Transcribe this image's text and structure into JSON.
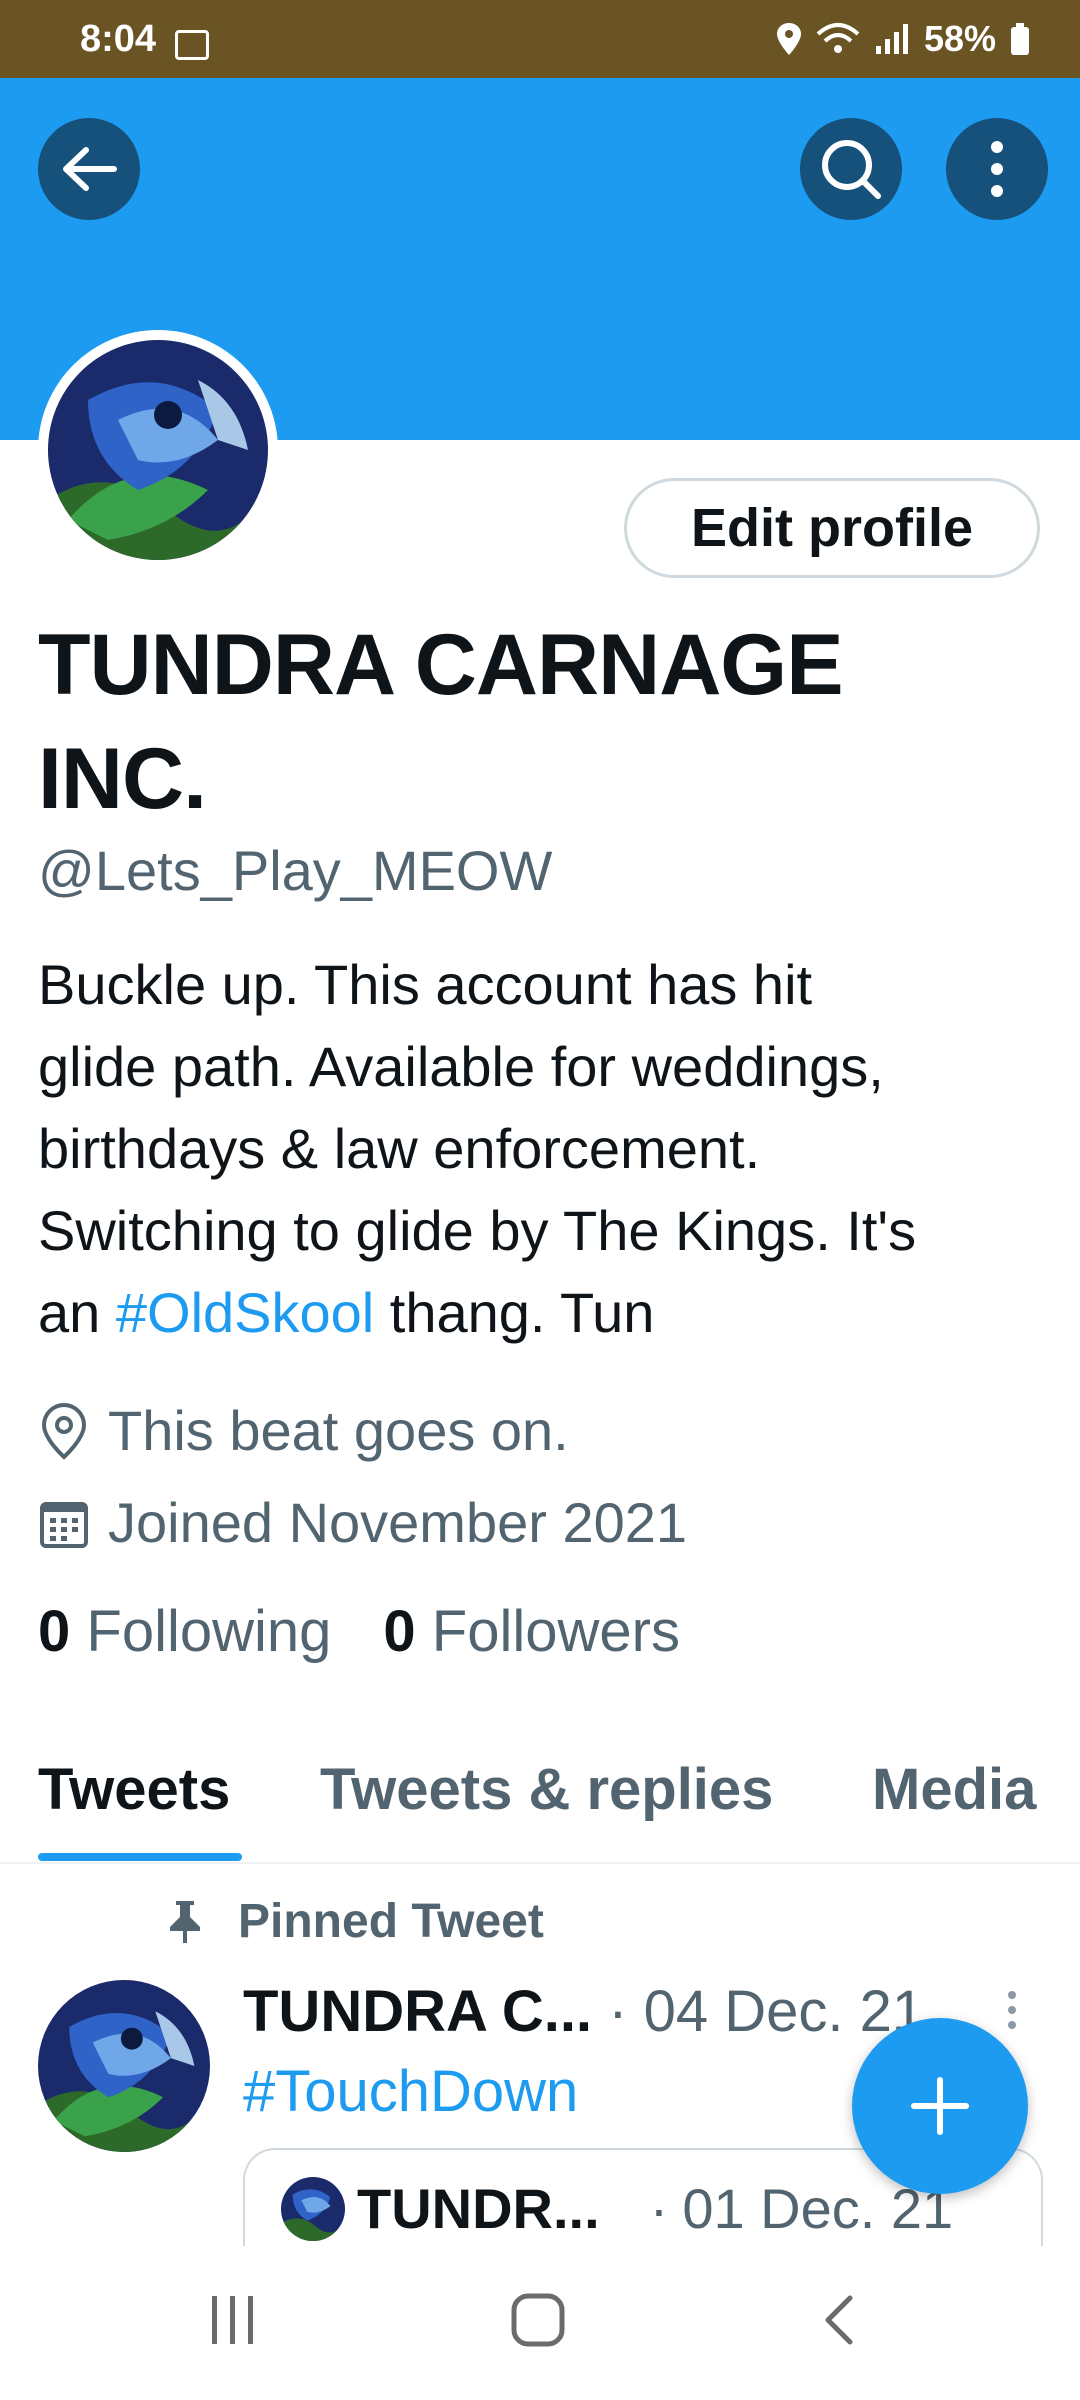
{
  "status_bar": {
    "time": "8:04",
    "battery": "58%"
  },
  "header": {
    "back_icon": "arrow-left-icon",
    "search_icon": "search-icon",
    "more_icon": "more-vertical-icon",
    "banner_color": "#1d9bf0"
  },
  "profile": {
    "edit_button": "Edit profile",
    "name_line1": "TUNDRA CARNAGE",
    "name_line2": "INC.",
    "handle": "@Lets_Play_MEOW",
    "bio_line1": "Buckle up. This account has hit",
    "bio_line2": "glide path. Available for weddings,",
    "bio_line3": "birthdays & law enforcement.",
    "bio_line4": "Switching to glide by The Kings. It's",
    "bio_line5_pre": "an ",
    "bio_hashtag": "#OldSkool",
    "bio_line5_post": " thang. Tun",
    "location": "This beat goes on.",
    "joined": "Joined November 2021",
    "following_count": "0",
    "following_label": "Following",
    "followers_count": "0",
    "followers_label": "Followers"
  },
  "tabs": [
    "Tweets",
    "Tweets & replies",
    "Media"
  ],
  "pinned_tweet": {
    "pinned_label": "Pinned Tweet",
    "author": "TUNDRA C...",
    "separator": "·",
    "date": "04 Dec. 21",
    "text": "#TouchDown",
    "quote": {
      "author": "TUNDR...",
      "separator": "·",
      "date": "01 Dec. 21"
    }
  },
  "fab": {
    "icon": "plus-icon"
  },
  "nav": {
    "recent_icon": "recent-apps-icon",
    "home_icon": "home-icon",
    "back_icon": "back-icon"
  },
  "colors": {
    "accent": "#1d9bf0",
    "text": "#0f1419",
    "secondary": "#536471"
  }
}
